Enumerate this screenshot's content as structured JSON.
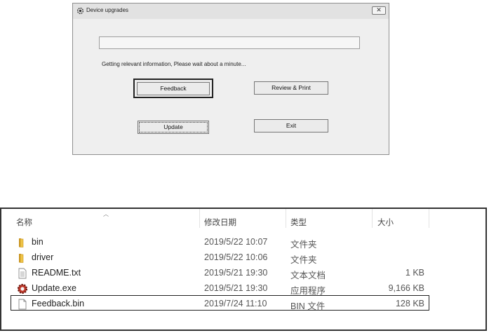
{
  "dialog": {
    "title": "Device upgrades",
    "close_label": "✕",
    "status_text": "Getting relevant information, Please wait about a minute...",
    "progress_value": 0,
    "buttons": {
      "feedback": "Feedback",
      "review_print": "Review & Print",
      "update": "Update",
      "exit": "Exit"
    }
  },
  "explorer": {
    "columns": {
      "name": "名称",
      "date": "修改日期",
      "type": "类型",
      "size": "大小"
    },
    "files": [
      {
        "name": "bin",
        "date": "2019/5/22 10:07",
        "type": "文件夹",
        "size": "",
        "icon": "folder-icon"
      },
      {
        "name": "driver",
        "date": "2019/5/22 10:06",
        "type": "文件夹",
        "size": "",
        "icon": "folder-icon"
      },
      {
        "name": "README.txt",
        "date": "2019/5/21 19:30",
        "type": "文本文档",
        "size": "1 KB",
        "icon": "text-file-icon"
      },
      {
        "name": "Update.exe",
        "date": "2019/5/21 19:30",
        "type": "应用程序",
        "size": "9,166 KB",
        "icon": "gear-app-icon"
      },
      {
        "name": "Feedback.bin",
        "date": "2019/7/24 11:10",
        "type": "BIN 文件",
        "size": "128 KB",
        "icon": "blank-file-icon"
      }
    ]
  },
  "colors": {
    "folder": "#e8b83a",
    "dialog_bg": "#efefef",
    "frame": "#222222"
  }
}
